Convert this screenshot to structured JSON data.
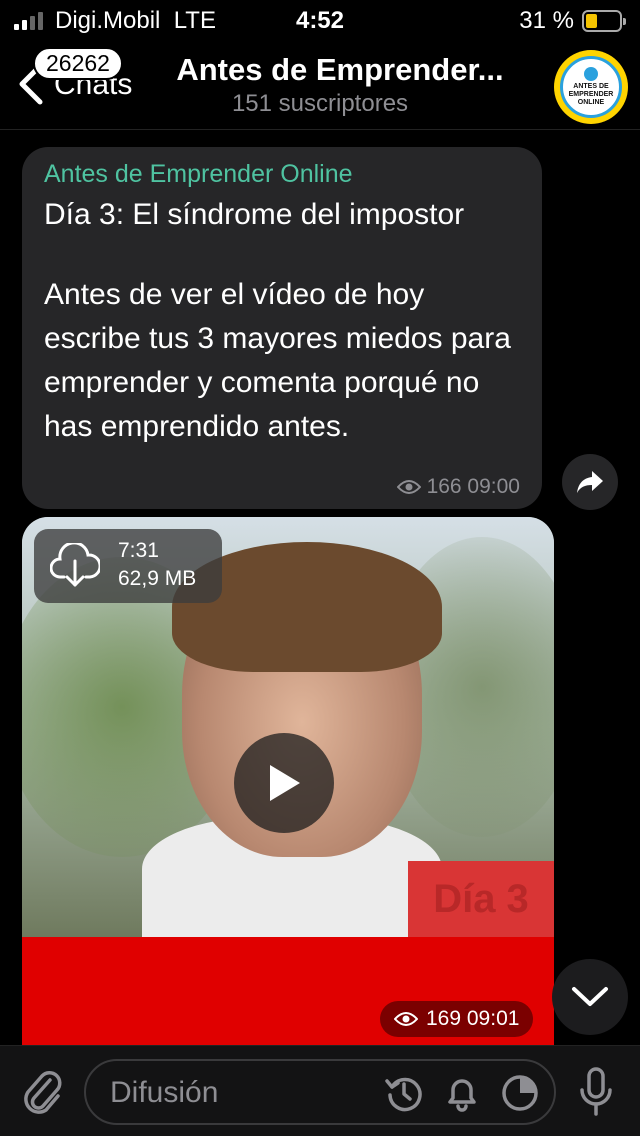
{
  "status_bar": {
    "carrier": "Digi.Mobil",
    "network": "LTE",
    "time": "4:52",
    "battery_percent": "31 %"
  },
  "header": {
    "back_label": "Chats",
    "unread_count": "26262",
    "title": "Antes de Emprender...",
    "subtitle": "151 suscriptores",
    "avatar_text": "ANTES DE EMPRENDER ONLINE"
  },
  "message_text": {
    "sender": "Antes de Emprender Online",
    "title": "Día 3: El síndrome del impostor",
    "body": "Antes de ver el vídeo de hoy escribe tus 3 mayores miedos para emprender y comenta porqué no has emprendido antes.",
    "views_time": "166 09:00"
  },
  "message_video": {
    "duration": "7:31",
    "size": "62,9 MB",
    "overlay_text": "Día 3",
    "views_time": "169 09:01"
  },
  "composer": {
    "placeholder": "Difusión"
  },
  "colors": {
    "accent_sender": "#4fc3a1",
    "bubble": "#262628",
    "video_red": "#e00000"
  },
  "icons": [
    "paperclip-icon",
    "clock-icon",
    "bell-icon",
    "moon-icon",
    "microphone-icon",
    "share-icon",
    "chevron-down-icon",
    "download-icon",
    "play-icon",
    "eye-icon",
    "back-arrow-icon"
  ]
}
